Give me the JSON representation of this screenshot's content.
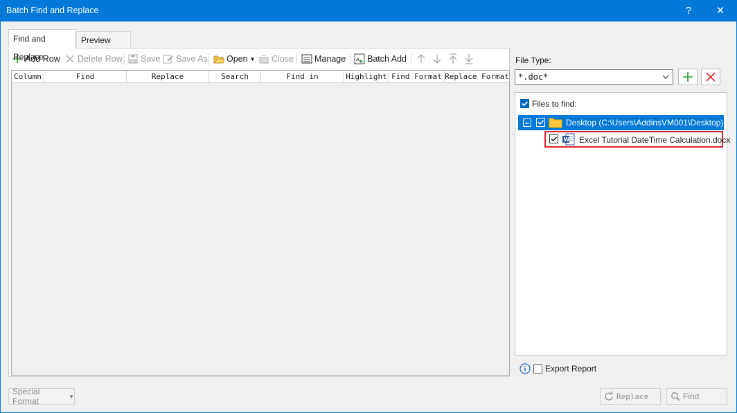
{
  "window": {
    "title": "Batch Find and Replace",
    "help": "?",
    "close": "✕"
  },
  "tabs": [
    {
      "label": "Find and Replace",
      "active": true
    },
    {
      "label": "Preview Result",
      "active": false
    }
  ],
  "toolbar": {
    "add_row": "Add Row",
    "delete_row": "Delete Row",
    "save": "Save",
    "save_as": "Save As",
    "open": "Open",
    "close": "Close",
    "manage": "Manage",
    "batch_add": "Batch Add"
  },
  "grid": {
    "columns": [
      "Column",
      "Find",
      "Replace",
      "Search",
      "Find in",
      "Highlight",
      "Find Format",
      "Replace Format"
    ],
    "rows": []
  },
  "file_type": {
    "label": "File Type:",
    "value": "*.doc*"
  },
  "files": {
    "header_label": "Files to find:",
    "folder": "Desktop (C:\\Users\\AddinsVM001\\Desktop)",
    "file": "Excel Tutorial DateTime Calculation.docx"
  },
  "footer": {
    "export_report": "Export Report",
    "special_format": "Special Format",
    "replace": "Replace",
    "find": "Find"
  },
  "colors": {
    "accent": "#0078d7",
    "highlight_border": "#e0242a",
    "add_green": "#2e9e3a",
    "remove_red": "#d9232a"
  }
}
